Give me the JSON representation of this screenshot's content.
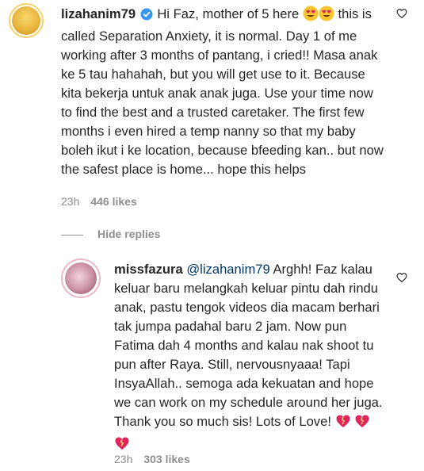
{
  "comments": [
    {
      "username": "lizahanim79",
      "verified": true,
      "text_before": "Hi Faz, mother of 5 here",
      "text_after": "this is called Separation Anxiety, it is normal. Day 1 of me working after 3 months of pantang, i cried!! Masa anak ke 5 tau hahahah, but you will get use to it. Because kita bekerja untuk anak anak juga. Use your time now to find the best and a trusted caretaker. The first few months i even hired a temp nanny so that my baby boleh ikut i ke location, because bfeeding kan.. but now the safest place is home... hope this helps",
      "emojis": [
        "heart-eyes-emoji",
        "heart-eyes-emoji"
      ],
      "time": "23h",
      "likes": "446 likes"
    },
    {
      "username": "missfazura",
      "mention": "@lizahanim79",
      "text": "Arghh! Faz kalau keluar baru melangkah keluar pintu dah rindu anak, pastu tengok videos dia macam berhari tak jumpa padahal baru 2 jam. Now pun Fatima dah 4 months and kalau nak shoot tu pun after Raya. Still, nervousnyaaa! Tapi InsyaAllah.. semoga ada kekuatan and hope we can work on my schedule around her juga. Thank you so much sis! Lots of Love!",
      "emojis": [
        "sparkling-heart-emoji",
        "sparkling-heart-emoji",
        "sparkling-heart-emoji"
      ],
      "time": "23h",
      "likes": "303 likes"
    }
  ],
  "hide_replies_label": "Hide replies",
  "colors": {
    "text": "#262626",
    "muted": "#8e8e8e",
    "verified": "#3897f0",
    "mention": "#00376b",
    "heart": "#e0245e"
  }
}
